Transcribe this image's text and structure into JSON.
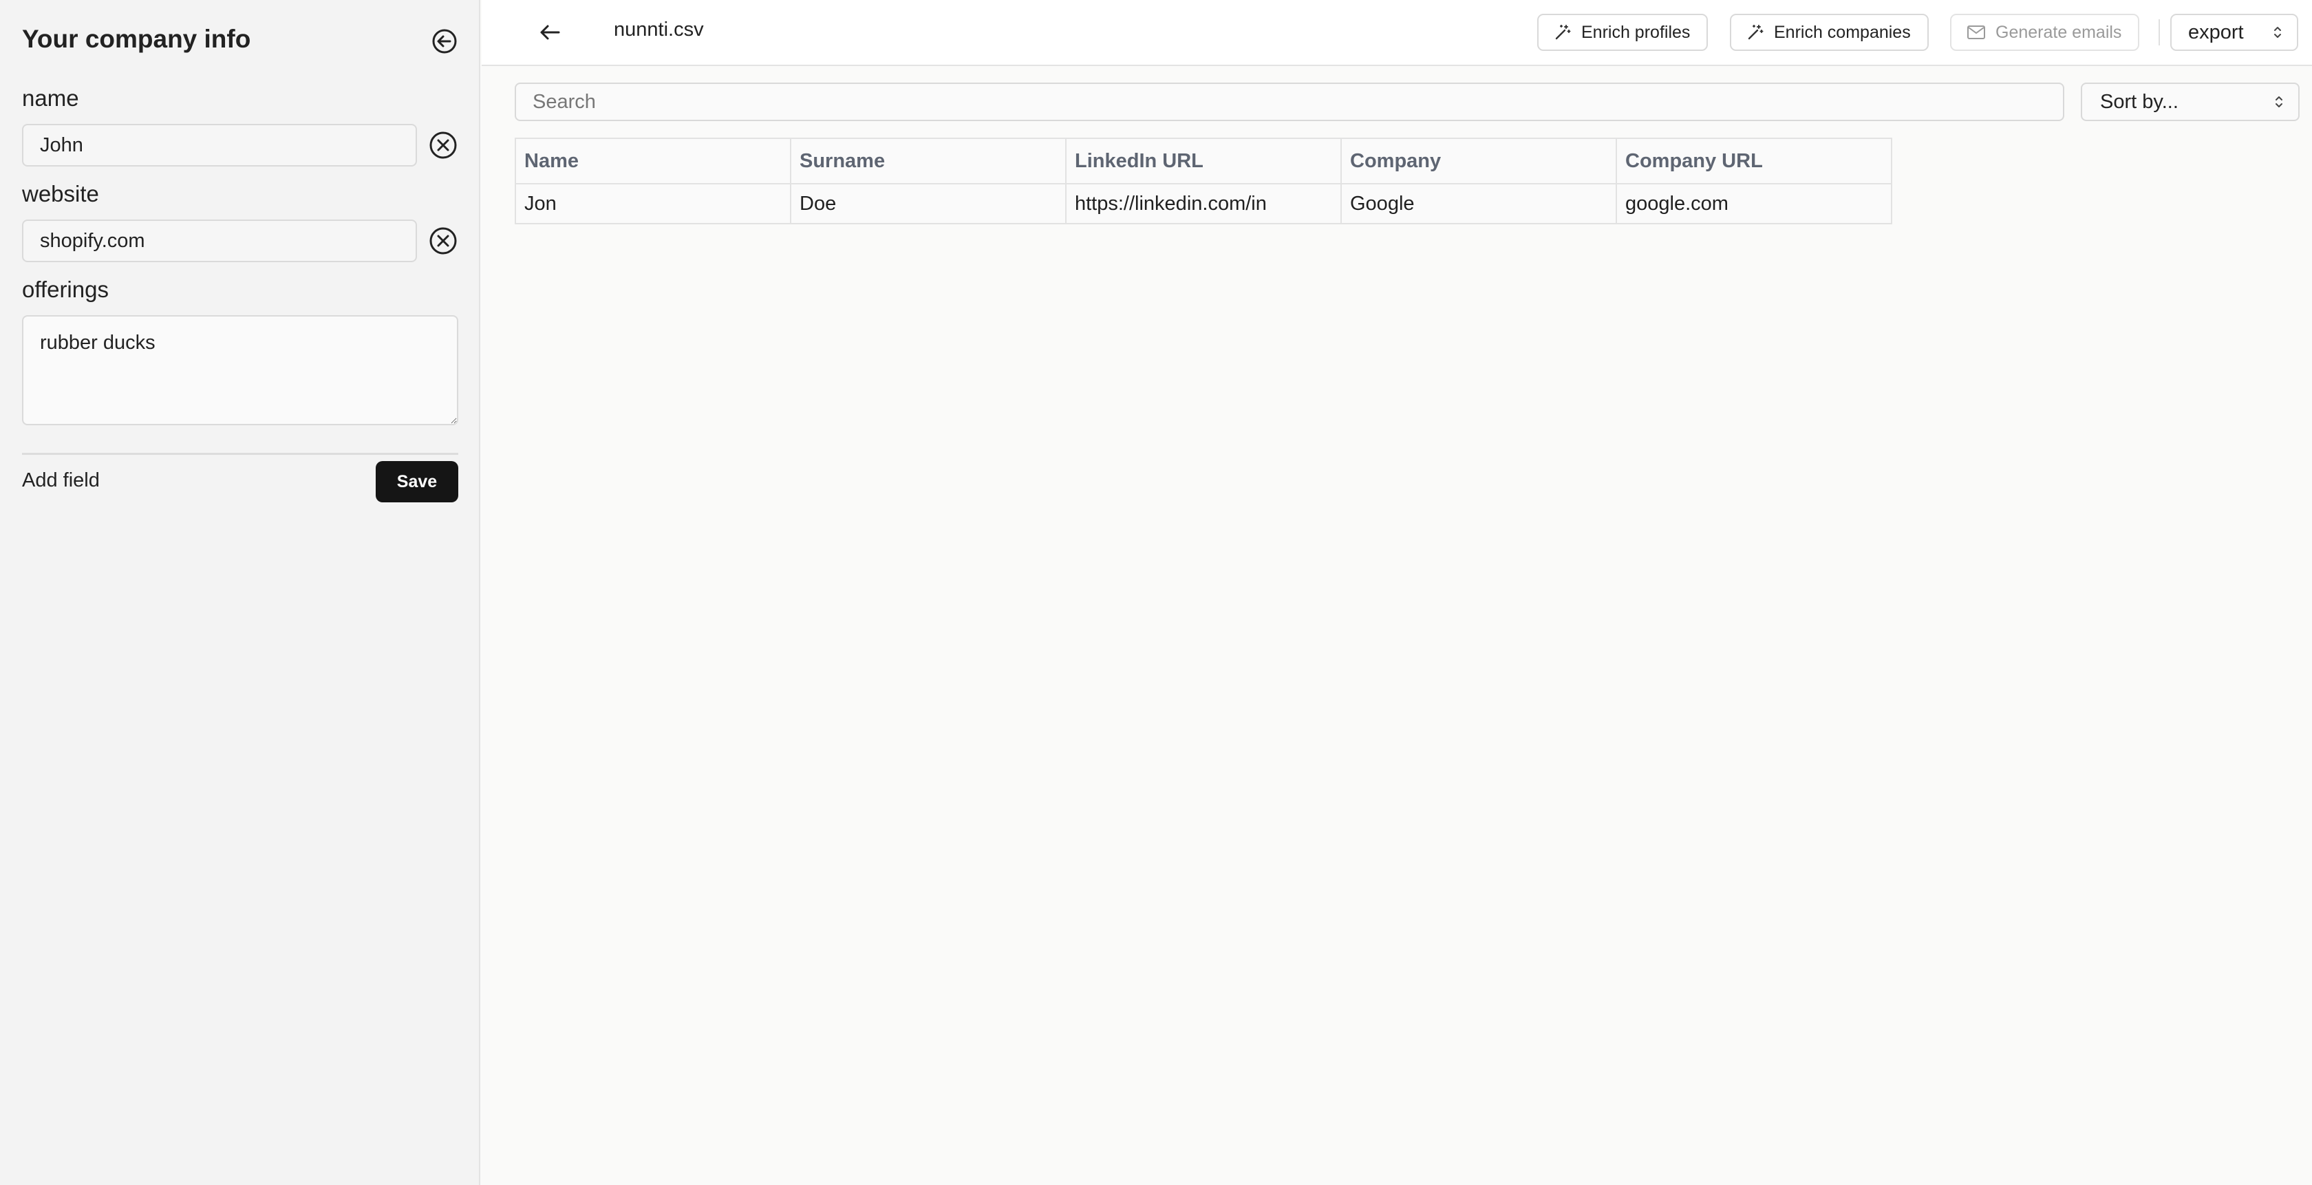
{
  "sidebar": {
    "title": "Your company info",
    "fields": [
      {
        "label": "name",
        "value": "John"
      },
      {
        "label": "website",
        "value": "shopify.com"
      }
    ],
    "offerings": {
      "label": "offerings",
      "value": "rubber ducks"
    },
    "add_field_label": "Add field",
    "save_label": "Save"
  },
  "topbar": {
    "file_name": "nunnti.csv",
    "enrich_profiles_label": "Enrich profiles",
    "enrich_companies_label": "Enrich companies",
    "generate_emails_label": "Generate emails",
    "export_label": "export"
  },
  "toolbar": {
    "search_placeholder": "Search",
    "sort_label": "Sort by..."
  },
  "table": {
    "columns": [
      "Name",
      "Surname",
      "LinkedIn URL",
      "Company",
      "Company URL"
    ],
    "rows": [
      [
        "Jon",
        "Doe",
        "https://linkedin.com/in",
        "Google",
        "google.com"
      ]
    ]
  }
}
